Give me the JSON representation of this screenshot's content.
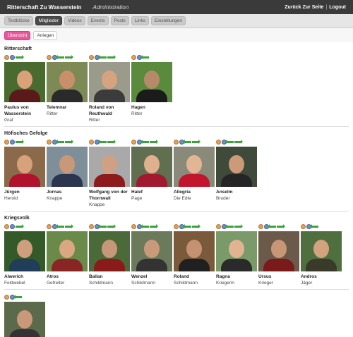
{
  "header": {
    "brand": "Ritterschaft Zu Wasserstein",
    "admin": "Administration",
    "back_link": "Zurück Zur Seite",
    "separator": "|",
    "logout": "Logout"
  },
  "tabs": [
    {
      "label": "Textblöcke",
      "active": false
    },
    {
      "label": "Mitglieder",
      "active": true
    },
    {
      "label": "Videos",
      "active": false
    },
    {
      "label": "Events",
      "active": false
    },
    {
      "label": "Posts",
      "active": false
    },
    {
      "label": "Links",
      "active": false
    },
    {
      "label": "Einstellungen",
      "active": false
    }
  ],
  "subtabs": [
    {
      "label": "Übersicht",
      "active": true
    },
    {
      "label": "Anlegen",
      "active": false
    }
  ],
  "sections": [
    {
      "title": "Ritterschaft",
      "members": [
        {
          "name": "Paulus von Wasserstein",
          "role": "Graf",
          "icons": [
            "person",
            "person2",
            "arrow-r"
          ],
          "bg": "#4a6b2f",
          "skin": "#d9a07a",
          "cloth": "#5a1a1a"
        },
        {
          "name": "Telemnar",
          "role": "Ritter",
          "icons": [
            "person",
            "person2",
            "arrow-l",
            "arrow-r"
          ],
          "bg": "#7d8a55",
          "skin": "#c98f6a",
          "cloth": "#2a2a2a"
        },
        {
          "name": "Roland von Reuthwald",
          "role": "Ritter",
          "icons": [
            "person",
            "person2",
            "arrow-l",
            "arrow-r"
          ],
          "bg": "#9b9b8b",
          "skin": "#d5a37e",
          "cloth": "#3b3b3b"
        },
        {
          "name": "Hagen",
          "role": "Ritter",
          "icons": [
            "person",
            "person2",
            "arrow-l"
          ],
          "bg": "#5a8a3c",
          "skin": "#b48a6a",
          "cloth": "#1b1b1b"
        }
      ]
    },
    {
      "title": "Höfisches Gefolge",
      "members": [
        {
          "name": "Jürgen",
          "role": "Herold",
          "icons": [
            "person",
            "person2",
            "arrow-r"
          ],
          "bg": "#8a6a4a",
          "skin": "#d7a17a",
          "cloth": "#b0132b"
        },
        {
          "name": "Jornas",
          "role": "Knappe",
          "icons": [
            "person",
            "person2",
            "arrow-l",
            "arrow-r"
          ],
          "bg": "#7f8f9a",
          "skin": "#c99878",
          "cloth": "#2b3550"
        },
        {
          "name": "Wolfgang von der Thornwall",
          "role": "Knappe",
          "icons": [
            "person",
            "person2",
            "arrow-l",
            "arrow-r"
          ],
          "bg": "#a9a9a9",
          "skin": "#d0a084",
          "cloth": "#8e1b1b"
        },
        {
          "name": "Halef",
          "role": "Page",
          "icons": [
            "person",
            "person2",
            "arrow-l",
            "arrow-r"
          ],
          "bg": "#5f6f4f",
          "skin": "#e0b08e",
          "cloth": "#a11a30"
        },
        {
          "name": "Allegria",
          "role": "Die Edle",
          "icons": [
            "person",
            "person2",
            "arrow-l",
            "arrow-r"
          ],
          "bg": "#8a8a7a",
          "skin": "#e2b695",
          "cloth": "#c2162f"
        },
        {
          "name": "Anselm",
          "role": "Bruder",
          "icons": [
            "person",
            "person2",
            "arrow-l",
            "arrow-r"
          ],
          "bg": "#3f4a3a",
          "skin": "#cc9a78",
          "cloth": "#252525"
        }
      ]
    },
    {
      "title": "Kriegsvolk",
      "members": [
        {
          "name": "Alwerich",
          "role": "Feldwebel",
          "icons": [
            "person",
            "person2",
            "arrow-r"
          ],
          "bg": "#355a2a",
          "skin": "#cf9f7d",
          "cloth": "#203d5a"
        },
        {
          "name": "Atros",
          "role": "Gefreiter",
          "icons": [
            "person",
            "person2",
            "arrow-l",
            "arrow-r"
          ],
          "bg": "#6a8a4a",
          "skin": "#d9a882",
          "cloth": "#8a2525"
        },
        {
          "name": "Ballan",
          "role": "Schildmann",
          "icons": [
            "person",
            "person2",
            "arrow-l",
            "arrow-r"
          ],
          "bg": "#4a6a3a",
          "skin": "#c7977a",
          "cloth": "#8a1b1b"
        },
        {
          "name": "Wenzel",
          "role": "Schildmann",
          "icons": [
            "person",
            "person2",
            "arrow-l",
            "arrow-r"
          ],
          "bg": "#6a7a5a",
          "skin": "#c89a7a",
          "cloth": "#333333"
        },
        {
          "name": "Roland",
          "role": "Schildmann",
          "icons": [
            "person",
            "person2",
            "arrow-l",
            "arrow-r"
          ],
          "bg": "#7a5a3a",
          "skin": "#c49272",
          "cloth": "#202020"
        },
        {
          "name": "Ragna",
          "role": "Kriegerin",
          "icons": [
            "person",
            "person2",
            "arrow-l",
            "arrow-r"
          ],
          "bg": "#7a9a6a",
          "skin": "#e1b391",
          "cloth": "#2a2a2a"
        },
        {
          "name": "Ursus",
          "role": "Krieger",
          "icons": [
            "person",
            "person2",
            "arrow-l",
            "arrow-r"
          ],
          "bg": "#6b5a4a",
          "skin": "#c69675",
          "cloth": "#7a1a1a"
        },
        {
          "name": "Andros",
          "role": "Jäger",
          "icons": [
            "person",
            "person2",
            "arrow-l"
          ],
          "bg": "#4f6f3f",
          "skin": "#d3a27f",
          "cloth": "#3a3a2a"
        }
      ]
    }
  ],
  "trailing_member": {
    "icons": [
      "person",
      "person2",
      "arrow-l"
    ],
    "bg": "#5a6a4a",
    "skin": "#c99878",
    "cloth": "#333333"
  }
}
